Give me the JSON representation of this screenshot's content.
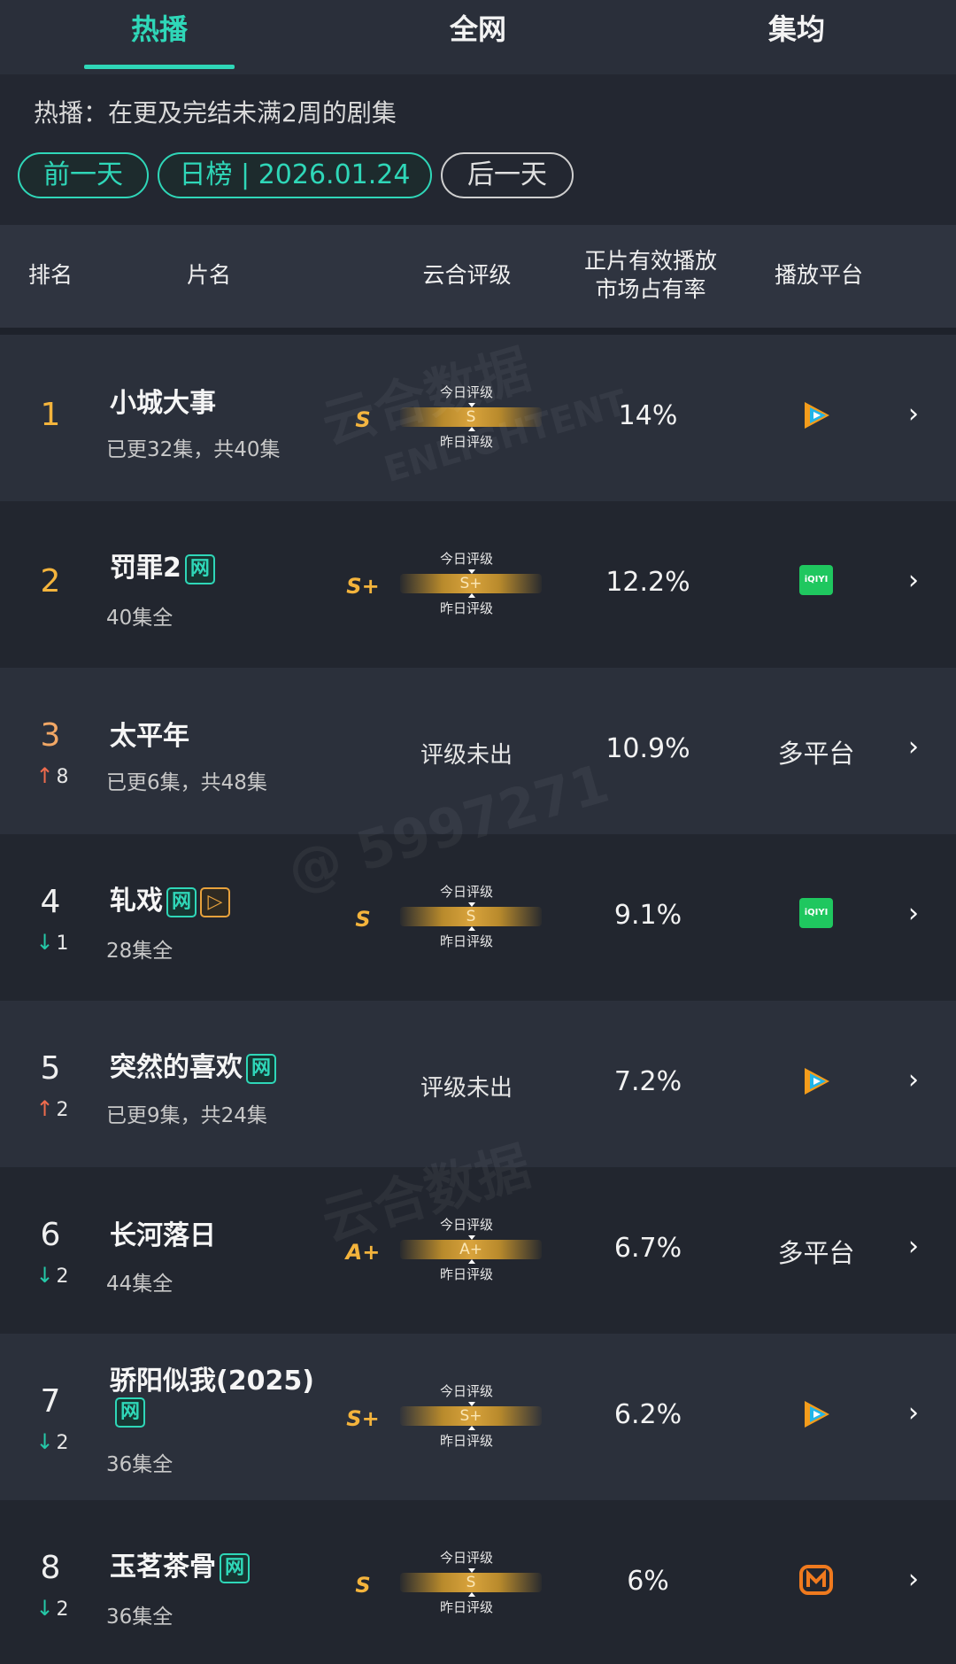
{
  "tabs": [
    "热播",
    "全网",
    "集均"
  ],
  "description": "热播：在更及完结未满2周的剧集",
  "buttons": {
    "prev": "前一天",
    "date": "日榜 | 2026.01.24",
    "next": "后一天"
  },
  "columns": {
    "rank": "排名",
    "title": "片名",
    "rating": "云合评级",
    "share_line1": "正片有效播放",
    "share_line2": "市场占有率",
    "platform": "播放平台"
  },
  "rating_labels": {
    "today": "今日评级",
    "yesterday": "昨日评级",
    "none": "评级未出"
  },
  "watermarks": [
    "云合数据",
    "ENLIGHTENT",
    "@ 5997271"
  ],
  "rows": [
    {
      "rank": "1",
      "trend": "",
      "title": "小城大事",
      "tags": [],
      "episodes": "已更32集，共40集",
      "grade": "S",
      "share": "14%",
      "platform": "tencent-video-icon",
      "platform_text": ""
    },
    {
      "rank": "2",
      "trend": "",
      "title": "罚罪2",
      "tags": [
        "网"
      ],
      "episodes": "40集全",
      "grade": "S+",
      "share": "12.2%",
      "platform": "iqiyi-icon",
      "platform_text": "iQIYI"
    },
    {
      "rank": "3",
      "trend": "8",
      "trend_dir": "up",
      "title": "太平年",
      "tags": [],
      "episodes": "已更6集，共48集",
      "grade": "",
      "share": "10.9%",
      "platform": "",
      "platform_text": "多平台"
    },
    {
      "rank": "4",
      "trend": "1",
      "trend_dir": "down",
      "title": "轧戏",
      "tags": [
        "网",
        "▷"
      ],
      "episodes": "28集全",
      "grade": "S",
      "share": "9.1%",
      "platform": "iqiyi-icon",
      "platform_text": "iQIYI"
    },
    {
      "rank": "5",
      "trend": "2",
      "trend_dir": "up",
      "title": "突然的喜欢",
      "tags": [
        "网"
      ],
      "episodes": "已更9集，共24集",
      "grade": "",
      "share": "7.2%",
      "platform": "tencent-video-icon",
      "platform_text": ""
    },
    {
      "rank": "6",
      "trend": "2",
      "trend_dir": "down",
      "title": "长河落日",
      "tags": [],
      "episodes": "44集全",
      "grade": "A+",
      "share": "6.7%",
      "platform": "",
      "platform_text": "多平台"
    },
    {
      "rank": "7",
      "trend": "2",
      "trend_dir": "down",
      "title": "骄阳似我(2025)",
      "tags": [
        "网"
      ],
      "episodes": "36集全",
      "grade": "S+",
      "share": "6.2%",
      "platform": "tencent-video-icon",
      "platform_text": ""
    },
    {
      "rank": "8",
      "trend": "2",
      "trend_dir": "down",
      "title": "玉茗茶骨",
      "tags": [
        "网"
      ],
      "episodes": "36集全",
      "grade": "S",
      "share": "6%",
      "platform": "mango-tv-icon",
      "platform_text": ""
    }
  ],
  "colors": {
    "accent": "#2fd7b8",
    "gold": "#f4b43c",
    "up": "#ee6b4d",
    "down": "#25c9a8",
    "iqiyi": "#1fc75f",
    "mango": "#f07a1e"
  }
}
